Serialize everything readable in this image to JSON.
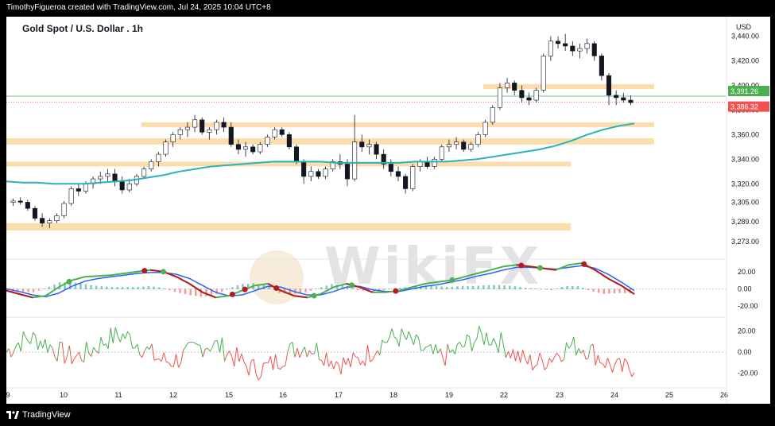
{
  "header": {
    "created_text": "TimothyFigueroa created with TradingView.com, Jul 24, 2025 10:04 UTC+8"
  },
  "footer": {
    "brand": "TradingView"
  },
  "watermark": "WikiFX",
  "colors": {
    "zone": "#fbd79e",
    "ma": "#26b3bd",
    "up": "#26a69a",
    "down": "#ef5350",
    "last_price": "#ef5350",
    "prev_price": "#4caf50",
    "wave_fast": "#4caf50",
    "wave_slow": "#2962ff",
    "wave_red": "#b71c1c",
    "osc_up": "#4caf50",
    "osc_down": "#ef5350"
  },
  "chart_data": {
    "type": "line",
    "title": "Gold Spot / U.S. Dollar . 1h",
    "unit": "USD",
    "x_ticks": [
      "9",
      "10",
      "11",
      "12",
      "15",
      "16",
      "17",
      "18",
      "19",
      "22",
      "23",
      "24",
      "25",
      "26"
    ],
    "price_ticks": [
      {
        "label": "3,440.00",
        "v": 3440
      },
      {
        "label": "3,420.00",
        "v": 3420
      },
      {
        "label": "3,400.00",
        "v": 3400
      },
      {
        "label": "3,380.00",
        "v": 3380
      },
      {
        "label": "3,360.00",
        "v": 3360
      },
      {
        "label": "3,340.00",
        "v": 3340
      },
      {
        "label": "3,320.00",
        "v": 3320
      },
      {
        "label": "3,305.00",
        "v": 3305
      },
      {
        "label": "3,289.00",
        "v": 3289
      },
      {
        "label": "3,273.00",
        "v": 3273
      }
    ],
    "price_labels": [
      {
        "label": "3,391.26",
        "v": 3391.26,
        "kind": "prev"
      },
      {
        "label": "3,386.32",
        "v": 3386.32,
        "kind": "last"
      }
    ],
    "zones": [
      {
        "from": 3397,
        "to": 3401,
        "x_end": "23.8"
      },
      {
        "from": 3367,
        "to": 3370,
        "x_end": "23.8"
      },
      {
        "from": 3352,
        "to": 3357,
        "x_end": "23.8"
      },
      {
        "from": 3336,
        "to": 3338,
        "x_end": "22.9"
      },
      {
        "from": 3282,
        "to": 3288,
        "x_end": "22.9"
      }
    ],
    "candles": [
      [
        3305,
        3308,
        3302,
        3306
      ],
      [
        3306,
        3309,
        3303,
        3305
      ],
      [
        3305,
        3307,
        3298,
        3300
      ],
      [
        3300,
        3302,
        3290,
        3292
      ],
      [
        3292,
        3296,
        3285,
        3288
      ],
      [
        3288,
        3292,
        3284,
        3290
      ],
      [
        3290,
        3296,
        3288,
        3294
      ],
      [
        3294,
        3306,
        3292,
        3304
      ],
      [
        3304,
        3318,
        3302,
        3316
      ],
      [
        3316,
        3320,
        3310,
        3314
      ],
      [
        3314,
        3322,
        3312,
        3320
      ],
      [
        3320,
        3326,
        3316,
        3324
      ],
      [
        3324,
        3330,
        3320,
        3326
      ],
      [
        3326,
        3332,
        3322,
        3328
      ],
      [
        3328,
        3332,
        3318,
        3322
      ],
      [
        3322,
        3326,
        3312,
        3315
      ],
      [
        3315,
        3324,
        3313,
        3320
      ],
      [
        3320,
        3328,
        3318,
        3326
      ],
      [
        3326,
        3334,
        3324,
        3332
      ],
      [
        3332,
        3340,
        3330,
        3338
      ],
      [
        3338,
        3346,
        3334,
        3344
      ],
      [
        3344,
        3356,
        3342,
        3354
      ],
      [
        3354,
        3362,
        3350,
        3360
      ],
      [
        3360,
        3366,
        3356,
        3364
      ],
      [
        3364,
        3370,
        3358,
        3366
      ],
      [
        3366,
        3376,
        3362,
        3372
      ],
      [
        3372,
        3374,
        3360,
        3362
      ],
      [
        3362,
        3366,
        3356,
        3364
      ],
      [
        3364,
        3372,
        3360,
        3370
      ],
      [
        3370,
        3374,
        3362,
        3366
      ],
      [
        3366,
        3370,
        3350,
        3352
      ],
      [
        3352,
        3356,
        3344,
        3348
      ],
      [
        3348,
        3354,
        3342,
        3350
      ],
      [
        3350,
        3352,
        3344,
        3346
      ],
      [
        3346,
        3354,
        3344,
        3352
      ],
      [
        3352,
        3360,
        3350,
        3358
      ],
      [
        3358,
        3366,
        3356,
        3364
      ],
      [
        3364,
        3366,
        3358,
        3360
      ],
      [
        3360,
        3362,
        3348,
        3350
      ],
      [
        3350,
        3352,
        3336,
        3338
      ],
      [
        3338,
        3340,
        3320,
        3326
      ],
      [
        3326,
        3334,
        3322,
        3330
      ],
      [
        3330,
        3332,
        3324,
        3326
      ],
      [
        3326,
        3334,
        3324,
        3332
      ],
      [
        3332,
        3340,
        3330,
        3338
      ],
      [
        3338,
        3344,
        3332,
        3336
      ],
      [
        3336,
        3340,
        3318,
        3324
      ],
      [
        3324,
        3376,
        3322,
        3354
      ],
      [
        3354,
        3360,
        3346,
        3350
      ],
      [
        3350,
        3356,
        3344,
        3352
      ],
      [
        3352,
        3354,
        3340,
        3344
      ],
      [
        3344,
        3348,
        3332,
        3336
      ],
      [
        3336,
        3340,
        3326,
        3330
      ],
      [
        3330,
        3334,
        3322,
        3326
      ],
      [
        3326,
        3328,
        3312,
        3316
      ],
      [
        3316,
        3336,
        3314,
        3334
      ],
      [
        3334,
        3340,
        3330,
        3338
      ],
      [
        3338,
        3342,
        3332,
        3334
      ],
      [
        3334,
        3342,
        3332,
        3340
      ],
      [
        3340,
        3352,
        3338,
        3350
      ],
      [
        3350,
        3356,
        3346,
        3352
      ],
      [
        3352,
        3358,
        3348,
        3354
      ],
      [
        3354,
        3356,
        3346,
        3348
      ],
      [
        3348,
        3354,
        3346,
        3352
      ],
      [
        3352,
        3362,
        3350,
        3360
      ],
      [
        3360,
        3372,
        3358,
        3370
      ],
      [
        3370,
        3384,
        3368,
        3382
      ],
      [
        3382,
        3402,
        3380,
        3398
      ],
      [
        3398,
        3406,
        3394,
        3402
      ],
      [
        3402,
        3404,
        3392,
        3396
      ],
      [
        3396,
        3400,
        3386,
        3390
      ],
      [
        3390,
        3394,
        3384,
        3388
      ],
      [
        3388,
        3398,
        3386,
        3396
      ],
      [
        3396,
        3426,
        3394,
        3424
      ],
      [
        3424,
        3440,
        3420,
        3436
      ],
      [
        3436,
        3440,
        3430,
        3434
      ],
      [
        3434,
        3442,
        3428,
        3432
      ],
      [
        3432,
        3436,
        3424,
        3428
      ],
      [
        3428,
        3434,
        3422,
        3430
      ],
      [
        3430,
        3438,
        3426,
        3434
      ],
      [
        3434,
        3436,
        3420,
        3424
      ],
      [
        3424,
        3426,
        3404,
        3408
      ],
      [
        3408,
        3410,
        3384,
        3392
      ],
      [
        3392,
        3396,
        3384,
        3390
      ],
      [
        3390,
        3394,
        3386,
        3388
      ],
      [
        3388,
        3392,
        3384,
        3386
      ]
    ],
    "ma": [
      3322,
      3321,
      3321,
      3320,
      3320,
      3320,
      3321,
      3322,
      3323,
      3325,
      3327,
      3330,
      3332,
      3334,
      3335,
      3336,
      3337,
      3338,
      3338,
      3338,
      3338,
      3337,
      3337,
      3337,
      3337,
      3337,
      3338,
      3338,
      3338,
      3339,
      3340,
      3342,
      3344,
      3346,
      3348,
      3351,
      3355,
      3360,
      3364,
      3367,
      3369
    ],
    "wave": {
      "range": [
        -30,
        30
      ],
      "ticks": [
        {
          "label": "20.00",
          "v": 20
        },
        {
          "label": "0.00",
          "v": 0
        },
        {
          "label": "-20.00",
          "v": -20
        }
      ],
      "fast": [
        -2,
        -6,
        -10,
        -8,
        2,
        10,
        14,
        15,
        16,
        18,
        20,
        22,
        20,
        14,
        6,
        -4,
        -10,
        -8,
        -2,
        4,
        6,
        -2,
        -8,
        -10,
        -6,
        2,
        6,
        2,
        -4,
        -4,
        -2,
        2,
        6,
        8,
        10,
        14,
        18,
        22,
        26,
        28,
        26,
        24,
        22,
        28,
        30,
        22,
        12,
        4,
        -6
      ],
      "slow": [
        0,
        -3,
        -7,
        -9,
        -5,
        3,
        9,
        12,
        14,
        16,
        18,
        19,
        19,
        17,
        12,
        4,
        -4,
        -8,
        -7,
        -2,
        3,
        2,
        -3,
        -7,
        -7,
        -3,
        2,
        3,
        -1,
        -3,
        -3,
        0,
        3,
        5,
        8,
        11,
        15,
        18,
        22,
        25,
        25,
        24,
        23,
        25,
        27,
        24,
        17,
        8,
        -2
      ],
      "crosses": [
        [
          0.1,
          "g"
        ],
        [
          0.22,
          "r"
        ],
        [
          0.25,
          "g"
        ],
        [
          0.36,
          "r"
        ],
        [
          0.38,
          "r"
        ],
        [
          0.43,
          "r"
        ],
        [
          0.49,
          "g"
        ],
        [
          0.55,
          "g"
        ],
        [
          0.62,
          "r"
        ],
        [
          0.71,
          "g"
        ],
        [
          0.82,
          "r"
        ],
        [
          0.85,
          "g"
        ],
        [
          0.92,
          "r"
        ]
      ]
    },
    "osc": {
      "range": [
        -30,
        30
      ],
      "ticks": [
        {
          "label": "20.00",
          "v": 20
        },
        {
          "label": "0.00",
          "v": 0
        },
        {
          "label": "-20.00",
          "v": -20
        }
      ]
    }
  }
}
